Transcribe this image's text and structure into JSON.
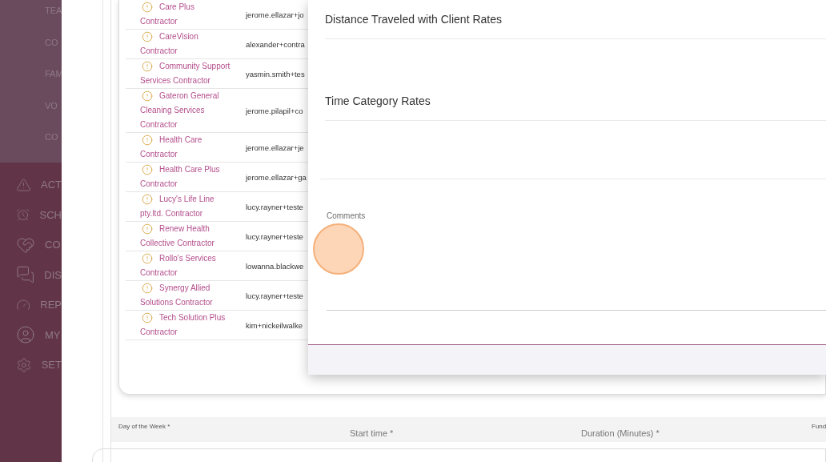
{
  "sidebar": {
    "submenu": [
      "TEA",
      "CO",
      "FAM",
      "VO",
      "CO"
    ],
    "menu": [
      "ACT",
      "SCH",
      "CO",
      "DIS",
      "REP",
      "MY",
      "SET"
    ]
  },
  "table": {
    "rows": [
      {
        "name": "Care Plus Contractor",
        "email": "jerome.ellazar+jo"
      },
      {
        "name": "CareVision Contractor",
        "email": "alexander+contra"
      },
      {
        "name": "Community Support Services Contractor",
        "email": "yasmin.smith+tes"
      },
      {
        "name": "Gateron General Cleaning Services Contractor",
        "email": "jerome.pilapil+co"
      },
      {
        "name": "Health Care Contractor",
        "email": "jerome.ellazar+je"
      },
      {
        "name": "Health Care Plus Contractor",
        "email": "jerome.ellazar+ga"
      },
      {
        "name": "Lucy's Life Line pty.ltd. Contractor",
        "email": "lucy.rayner+teste"
      },
      {
        "name": "Renew Health Collective Contractor",
        "email": "lucy.rayner+teste"
      },
      {
        "name": "Rollo's Services Contractor",
        "email": "lowanna.blackwe"
      },
      {
        "name": "Synergy Allied Solutions Contractor",
        "email": "lucy.rayner+teste"
      },
      {
        "name": "Tech Solution Plus Contractor",
        "email": "kim+nickeilwalke"
      }
    ]
  },
  "modal": {
    "sections": [
      "Distance Traveled with Client Rates",
      "Time Category Rates"
    ],
    "comments": {
      "placeholder": "Comments"
    }
  },
  "form": {
    "day_label": "Day of the Week *",
    "start_label": "Start time *",
    "duration_label": "Duration (Minutes) *",
    "column_4": "Fund"
  }
}
